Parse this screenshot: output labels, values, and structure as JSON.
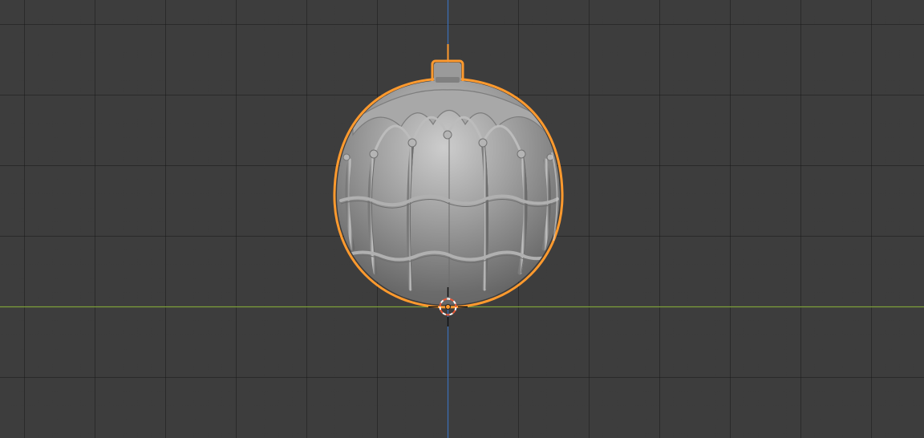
{
  "viewport": {
    "kind": "3d-viewport",
    "view": "front-orthographic"
  },
  "scene": {
    "object": "christmas-ornament-ball",
    "selected": true
  },
  "colors": {
    "background": "#3d3d3d",
    "grid_line": "#2e2e2e",
    "x_axis": "#7ea13a",
    "z_axis": "#3c6fb8",
    "selection_outline": "#ff9a2e",
    "mesh_base": "#8f8f8f",
    "mesh_highlight": "#c8c8c8",
    "mesh_shadow": "#5e5e5e",
    "cursor_ring": "#e85a3a"
  },
  "icons": [
    "3d-cursor-icon",
    "origin-point-icon"
  ]
}
